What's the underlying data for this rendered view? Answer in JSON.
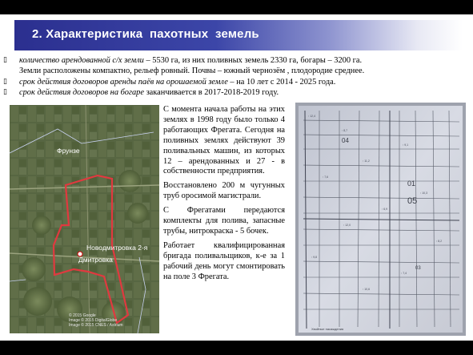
{
  "header": {
    "title": "2. Характеристика  пахотных  земель"
  },
  "bullets": [
    {
      "italic": "количество арендованной с/х земли",
      "text": " – 5530 га, из них поливных земель 2330 га, богары – 3200 га."
    },
    {
      "italic": "",
      "text": "Земли расположены компактно, рельеф ровный. Почвы – южный чернозём , плодородие среднее."
    },
    {
      "italic": " срок действия договоров аренды паёв на орошаемой земле",
      "text": " – на 10 лет с 2014 - 2025 года."
    },
    {
      "italic": "срок действия договоров на богаре",
      "text": "  заканчивается в 2017-2018-2019 году."
    }
  ],
  "satellite_map": {
    "labels": {
      "village1": "Фрунзе",
      "village2": "Новодмитровка 2-я",
      "village3": "Дмитровка"
    },
    "attribution": [
      "© 2015 Google",
      "Image © 2015 DigitalGlobe",
      "Image © 2015 CNES / Astrium"
    ]
  },
  "cadastral_map": {
    "labels": {
      "top_num": "04",
      "num1": "01",
      "num2": "05",
      "num3": "03",
      "bottom": "Хвойные насаждения"
    }
  },
  "description": [
    "С момента начала работы на этих землях в 1998 году было только 4 работающих Фрегата. Сегодня на поливных землях действуют 39 поливальных машин, из которых 12 – арендованных и 27 - в собственности предприятия.",
    "Восстановлено 200 м чугунных труб оросимой магистрали.",
    "С Фрегатами передаются комплекты для полива, запасные трубы, нитрокраска - 5 бочек.",
    "Работает квалифицированная бригада поливальщиков, к-е за 1 рабочий день могут смонтировать на поле 3 Фрегата."
  ],
  "colors": {
    "header_dark": "#2b2f8f",
    "boundary": "#e0393f"
  }
}
